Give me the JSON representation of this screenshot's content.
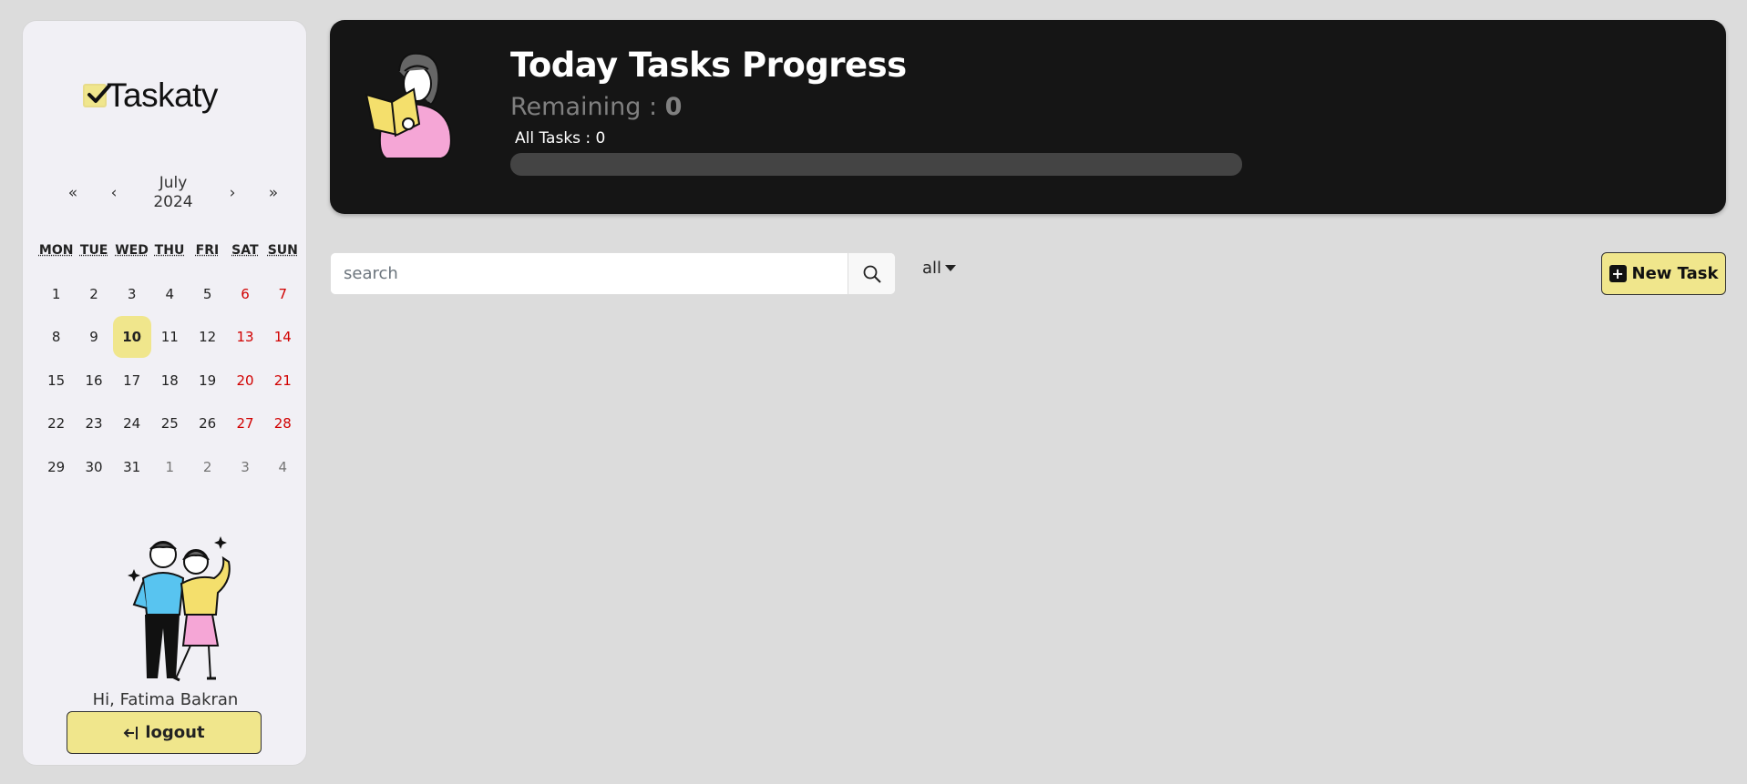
{
  "app": {
    "name": "Taskaty"
  },
  "calendar": {
    "month": "July",
    "year": "2024",
    "nav": {
      "prev_year": "«",
      "prev_month": "‹",
      "next_month": "›",
      "next_year": "»"
    },
    "weekdays": [
      "MON",
      "TUE",
      "WED",
      "THU",
      "FRI",
      "SAT",
      "SUN"
    ],
    "selected_day": "10",
    "weeks": [
      [
        "1",
        "2",
        "3",
        "4",
        "5",
        "6",
        "7"
      ],
      [
        "8",
        "9",
        "10",
        "11",
        "12",
        "13",
        "14"
      ],
      [
        "15",
        "16",
        "17",
        "18",
        "19",
        "20",
        "21"
      ],
      [
        "22",
        "23",
        "24",
        "25",
        "26",
        "27",
        "28"
      ],
      [
        "29",
        "30",
        "31",
        "1",
        "2",
        "3",
        "4"
      ]
    ],
    "next_month_days_in_last_week": 4
  },
  "user": {
    "greeting": "Hi, Fatima Bakran"
  },
  "logout": {
    "label": "logout",
    "icon": "logout-arrow-icon"
  },
  "progress": {
    "title": "Today Tasks Progress",
    "remaining_label": "Remaining : ",
    "remaining_count": "0",
    "all_tasks": "All Tasks : 0",
    "fraction": 0
  },
  "search": {
    "placeholder": "search",
    "value": "",
    "icon": "search-icon"
  },
  "filter": {
    "selected": "all"
  },
  "new_task": {
    "label": "New Task",
    "icon": "plus-square-icon"
  },
  "colors": {
    "accent": "#f0e68c",
    "card": "#151515",
    "weekend": "#d10000",
    "background": "#dcdcdc"
  }
}
